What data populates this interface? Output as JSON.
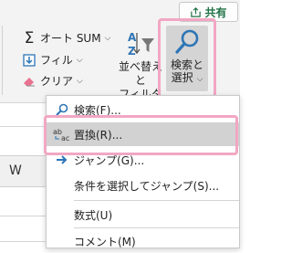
{
  "ribbon": {
    "share_label": "共有",
    "autosum_label": "オート SUM",
    "fill_label": "フィル",
    "clear_label": "クリア",
    "sort_filter_line1": "並べ替えと",
    "sort_filter_line2": "フィルター",
    "find_select_line1": "検索と",
    "find_select_line2": "選択"
  },
  "sheet": {
    "column_label": "W"
  },
  "menu": {
    "items": [
      {
        "label": "検索(F)...",
        "icon": "search-icon"
      },
      {
        "label": "置換(R)...",
        "icon": "replace-icon"
      },
      {
        "label": "ジャンプ(G)...",
        "icon": "goto-arrow-icon"
      },
      {
        "label": "条件を選択してジャンプ(S)...",
        "icon": ""
      },
      {
        "label": "数式(U)",
        "icon": ""
      },
      {
        "label": "コメント(M)",
        "icon": ""
      }
    ]
  },
  "colors": {
    "highlight": "#f2a7c3",
    "selected": "#d2d2d2",
    "find_icon_blue": "#2e75b6",
    "share_green": "#217346"
  }
}
